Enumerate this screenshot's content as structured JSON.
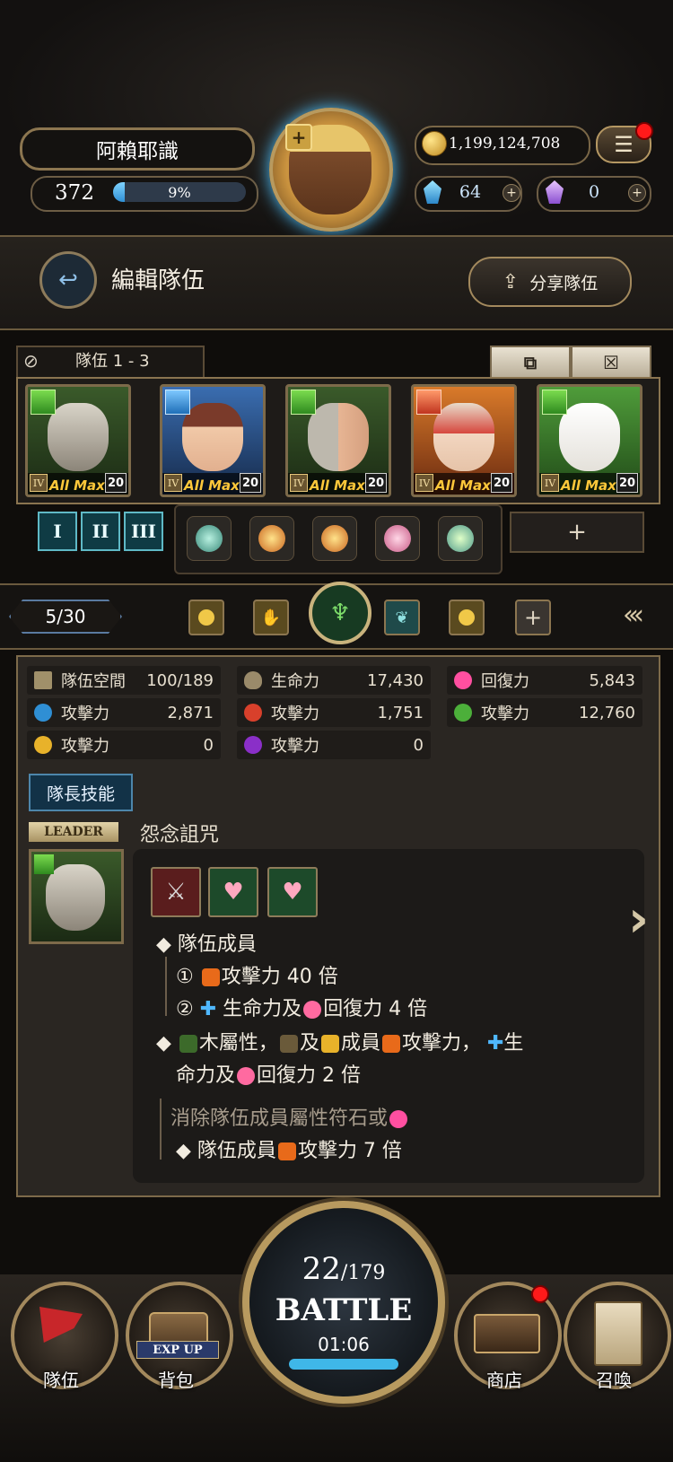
{
  "player": {
    "name": "阿賴耶識",
    "level": "372",
    "exp_percent_text": "9%",
    "exp_fraction": 0.09
  },
  "currency": {
    "coins": "1,199,124,708",
    "diamonds": "64",
    "crystals": "0"
  },
  "header": {
    "title": "編輯隊伍",
    "share_label": "分享隊伍"
  },
  "team": {
    "tab_label": "隊伍 1 - 3",
    "members": [
      {
        "rank": "IV",
        "max_label": "All Max",
        "level": "20",
        "attribute": "wood"
      },
      {
        "rank": "IV",
        "max_label": "All Max",
        "level": "20",
        "attribute": "water"
      },
      {
        "rank": "IV",
        "max_label": "All Max",
        "level": "20",
        "attribute": "wood"
      },
      {
        "rank": "IV",
        "max_label": "All Max",
        "level": "20",
        "attribute": "fire"
      },
      {
        "rank": "IV",
        "max_label": "All Max",
        "level": "20",
        "attribute": "wood"
      }
    ],
    "formation_buttons": [
      "I",
      "II",
      "III"
    ],
    "add_label": "+"
  },
  "filter": {
    "count": "5/30",
    "add_label": "+"
  },
  "stats": {
    "team_space_label": "隊伍空間",
    "team_space_value": "100/189",
    "hp_label": "生命力",
    "hp_value": "17,430",
    "recovery_label": "回復力",
    "recovery_value": "5,843",
    "water_atk_label": "攻擊力",
    "water_atk_value": "2,871",
    "fire_atk_label": "攻擊力",
    "fire_atk_value": "1,751",
    "wood_atk_label": "攻擊力",
    "wood_atk_value": "12,760",
    "light_atk_label": "攻擊力",
    "light_atk_value": "0",
    "dark_atk_label": "攻擊力",
    "dark_atk_value": "0"
  },
  "leader": {
    "skill_button": "隊長技能",
    "tag": "LEADER",
    "skill_name": "怨念詛咒",
    "lines": {
      "l1": "隊伍成員",
      "l2_num": "①",
      "l2": "攻擊力 40 倍",
      "l3_num": "②",
      "l3a": "生命力及",
      "l3b": "回復力 4 倍",
      "l4a": "木屬性，",
      "l4b": "及",
      "l4c": "成員",
      "l4d": "攻擊力，",
      "l4e": "生",
      "l5a": "命力及",
      "l5b": "回復力 2 倍",
      "l6": "消除隊伍成員屬性符石或",
      "l7a": "隊伍成員",
      "l7b": "攻擊力 7 倍"
    }
  },
  "battle": {
    "stamina_current": "22",
    "stamina_max": "/179",
    "label": "BATTLE",
    "timer": "01:06"
  },
  "nav": {
    "team": "隊伍",
    "bag": "背包",
    "exp_up": "EXP UP",
    "shop": "商店",
    "summon": "召喚"
  },
  "colors": {
    "gold": "#a98a55",
    "wood": "#4caf3a",
    "water": "#2f8fd4",
    "fire": "#d8402b",
    "light": "#e8b22a",
    "dark": "#8a2fc8",
    "heart": "#ff6aa0"
  }
}
